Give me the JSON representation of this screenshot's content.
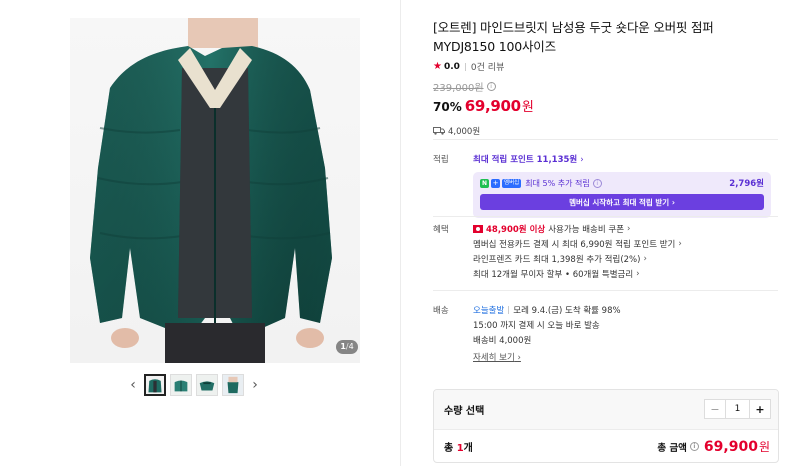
{
  "gallery": {
    "counter_current": "1",
    "counter_total": "4",
    "counter_sep": "/",
    "prev_arrow": "‹",
    "next_arrow": "›",
    "thumbs": [
      "thumb-1",
      "thumb-2",
      "thumb-3",
      "thumb-4"
    ]
  },
  "product": {
    "title": "[오트렌] 마인드브릿지 남성용 두굿 숏다운 오버핏 점퍼 MYDJ8150 100사이즈",
    "rating_star": "★",
    "rating_score": "0.0",
    "review_count": "0건 리뷰",
    "original_price": "239,000원",
    "info_icon": "i",
    "discount": "70%",
    "price": "69,900",
    "won": "원",
    "shipping_fee": "4,000원"
  },
  "reward": {
    "label": "적립",
    "max_points": "최대 적립 포인트 11,135원",
    "gt": "›",
    "npay_badge": "N",
    "plus_badge": "+",
    "member_badge": "멤버십",
    "extra_text": "최대 5% 추가 적립",
    "extra_amount": "2,796원",
    "button": "멤버십 시작하고 최대 적립 받기 ›"
  },
  "benefits": {
    "label": "혜택",
    "line1_amount": "48,900원 이상",
    "line1_text": "사용가능 배송비 쿠폰",
    "line2": "멤버십 전용카드 결제 시 최대 6,990원 적립 포인트 받기",
    "line3": "라인프렌즈 카드 최대 1,398원 추가 적립(2%)",
    "line4": "최대 12개월 무이자 할부 • 60개월 특별금리",
    "gt": "›"
  },
  "delivery": {
    "label": "배송",
    "today": "오늘출발",
    "arrival": "모레 9.4.(금) 도착 확률 98%",
    "cutoff": "15:00 까지 결제 시 오늘 바로 발송",
    "fee": "배송비 4,000원",
    "more": "자세히 보기",
    "gt": "›"
  },
  "quantity": {
    "title": "수량 선택",
    "minus": "−",
    "value": "1",
    "plus": "+",
    "total_prefix": "총 ",
    "total_count": "1",
    "total_suffix": "개",
    "total_label": "총 금액",
    "total_price": "69,900",
    "total_won": "원"
  },
  "colors": {
    "accent_red": "#e3002d",
    "membership_purple": "#6b3fe0",
    "jacket_green": "#1e6b62"
  }
}
